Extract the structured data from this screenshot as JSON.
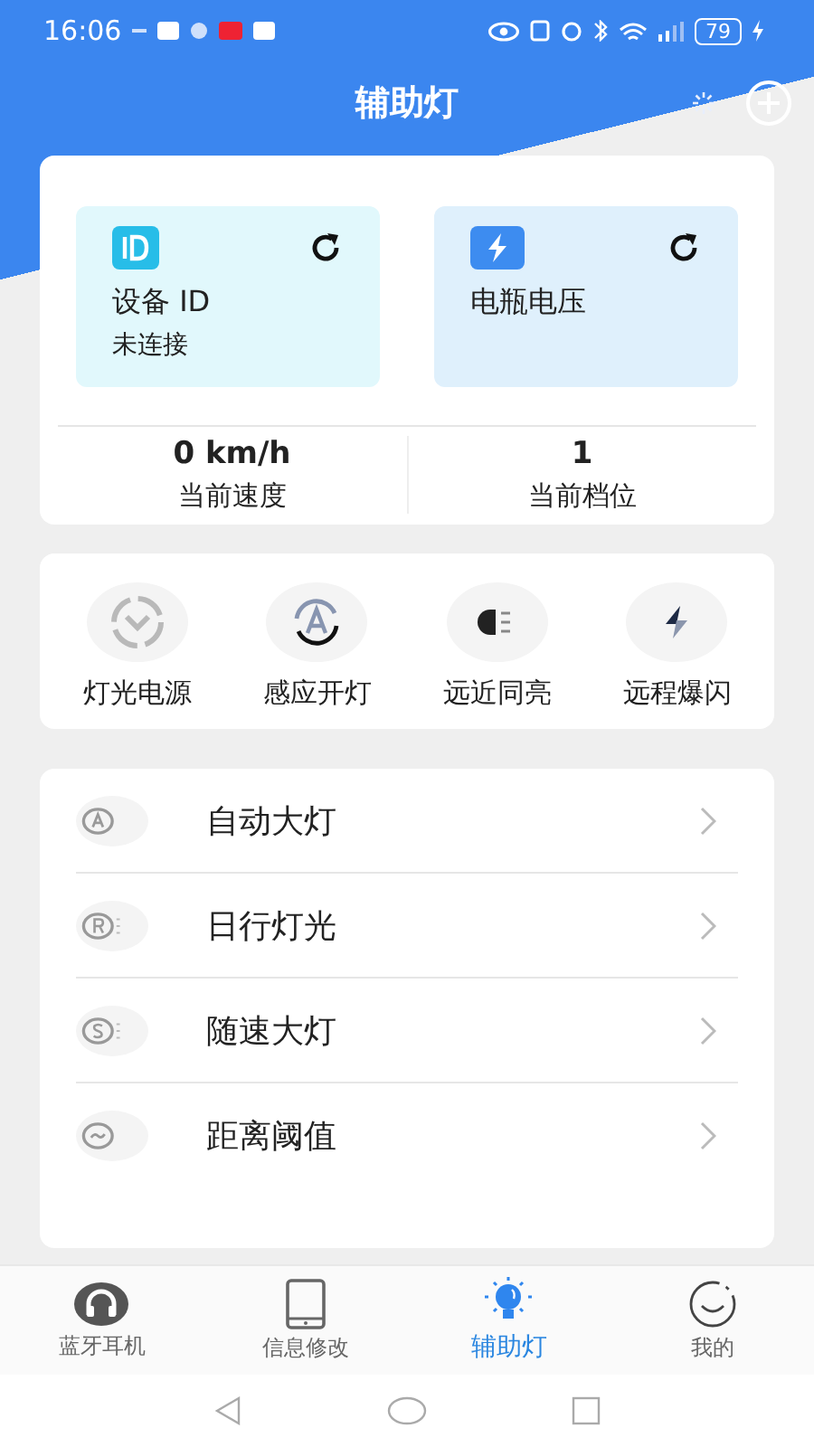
{
  "status_bar": {
    "time": "16:06",
    "battery": "79"
  },
  "title": "辅助灯",
  "info_tiles": [
    {
      "title": "设备 ID",
      "value": "未连接"
    },
    {
      "title": "电瓶电压"
    }
  ],
  "stats": [
    {
      "value": "0 km/h",
      "label": "当前速度"
    },
    {
      "value": "1",
      "label": "当前档位"
    }
  ],
  "quick_actions": [
    {
      "label": "灯光电源"
    },
    {
      "label": "感应开灯"
    },
    {
      "label": "远近同亮"
    },
    {
      "label": "远程爆闪"
    }
  ],
  "settings": [
    {
      "label": "自动大灯"
    },
    {
      "label": "日行灯光"
    },
    {
      "label": "随速大灯"
    },
    {
      "label": "距离阈值"
    }
  ],
  "tabs": [
    {
      "label": "蓝牙耳机",
      "selected": false
    },
    {
      "label": "信息修改",
      "selected": false
    },
    {
      "label": "辅助灯",
      "selected": true
    },
    {
      "label": "我的",
      "selected": false
    }
  ]
}
